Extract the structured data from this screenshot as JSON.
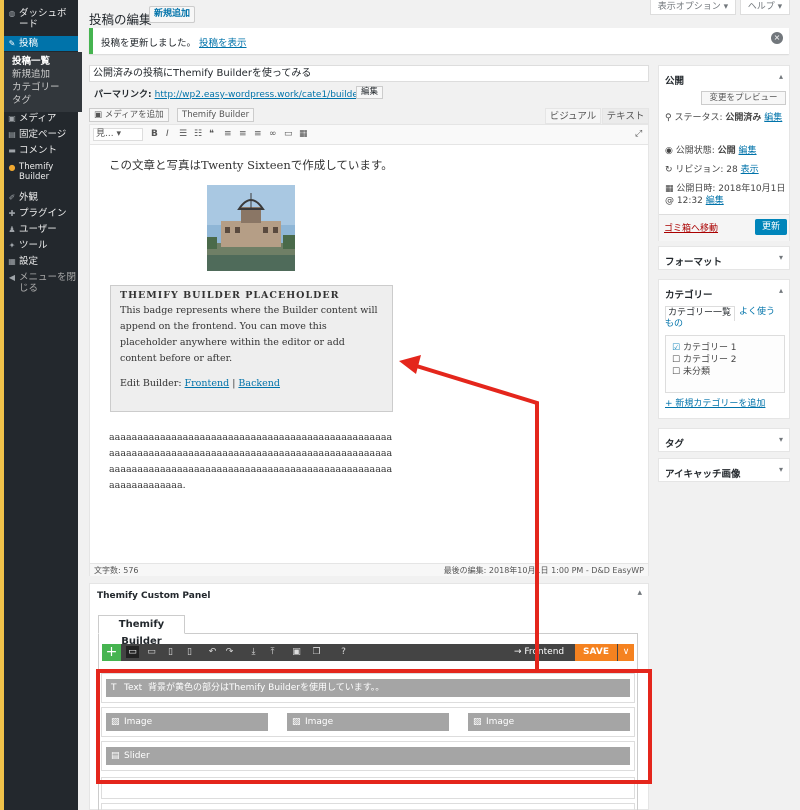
{
  "admin_menu": {
    "dashboard": "ダッシュボード",
    "posts": "投稿",
    "post_sub": [
      "投稿一覧",
      "新規追加",
      "カテゴリー",
      "タグ"
    ],
    "media": "メディア",
    "pages": "固定ページ",
    "comments": "コメント",
    "themify": "Themify Builder",
    "appearance": "外観",
    "plugins": "プラグイン",
    "users": "ユーザー",
    "tools": "ツール",
    "settings": "設定",
    "collapse": "メニューを閉じる"
  },
  "header": {
    "title": "投稿の編集",
    "new_button": "新規追加",
    "screen_options": "表示オプション ▾",
    "help": "ヘルプ ▾"
  },
  "notice": {
    "text": "投稿を更新しました。",
    "link": "投稿を表示"
  },
  "post": {
    "title": "公開済みの投稿にThemify Builderを使ってみる",
    "permalink_label": "パーマリンク:",
    "permalink_url": "http://wp2.easy-wordpress.work/cate1/builder/",
    "permalink_edit": "編集"
  },
  "editor": {
    "add_media": "メディアを追加",
    "themify_builder_btn": "Themify Builder",
    "tab_visual": "ビジュアル",
    "tab_text": "テキスト",
    "format_select": "見...",
    "intro": "この文章と写真はTwenty Sixteenで作成しています。",
    "placeholder_title": "THEMIFY BUILDER PLACEHOLDER",
    "placeholder_body": "This badge represents where the Builder content will append on the frontend. You can move this placeholder anywhere within the editor or add content before or after.",
    "placeholder_edit_label": "Edit Builder:",
    "placeholder_frontend": "Frontend",
    "placeholder_sep": " | ",
    "placeholder_backend": "Backend",
    "aaa_text": "aaaaaaaaaaaaaaaaaaaaaaaaaaaaaaaaaaaaaaaaaaaaaaaaaaaaaaaaaaaaaaaaaaaaaaaaaaaaaaaaaaaaaaaaaaaaaaaaaaaaaaaaaaaaaaaaaaaaaaaaaaaaaaaaaaaaaaaaaaaaaaaaaaaaaaaaaaaaaaaaaaa.",
    "word_count": "文字数: 576",
    "last_edit": "最後の編集: 2018年10月1日 1:00 PM - D&D EasyWP"
  },
  "themify_panel": {
    "title": "Themify Custom Panel",
    "tab": "Themify Builder",
    "frontend": "Frontend",
    "save": "SAVE",
    "text_module": "Text",
    "text_module_desc": "背景が黄色の部分はThemify Builderを使用しています。。",
    "image_modules": [
      "Image",
      "Image",
      "Image"
    ],
    "slider_module": "Slider"
  },
  "sidebar": {
    "publish": {
      "title": "公開",
      "preview": "変更をプレビュー",
      "status_label": "ステータス:",
      "status_value": "公開済み",
      "status_edit": "編集",
      "visibility_label": "公開状態:",
      "visibility_value": "公開",
      "visibility_edit": "編集",
      "revisions_label": "リビジョン: 28",
      "revisions_link": "表示",
      "date_label": "公開日時:",
      "date_value": "2018年10月1日 @ 12:32",
      "date_edit": "編集",
      "trash": "ゴミ箱へ移動",
      "update": "更新"
    },
    "format": "フォーマット",
    "categories": {
      "title": "カテゴリー",
      "tab_all": "カテゴリー一覧",
      "tab_popular": "よく使うもの",
      "items": [
        "カテゴリー 1",
        "カテゴリー 2",
        "未分類"
      ],
      "add": "+ 新規カテゴリーを追加"
    },
    "tags": "タグ",
    "featured": "アイキャッチ画像"
  },
  "colors": {
    "accent": "#0073aa",
    "highlight": "#e4261c",
    "save": "#f58220",
    "add": "#46b450"
  }
}
